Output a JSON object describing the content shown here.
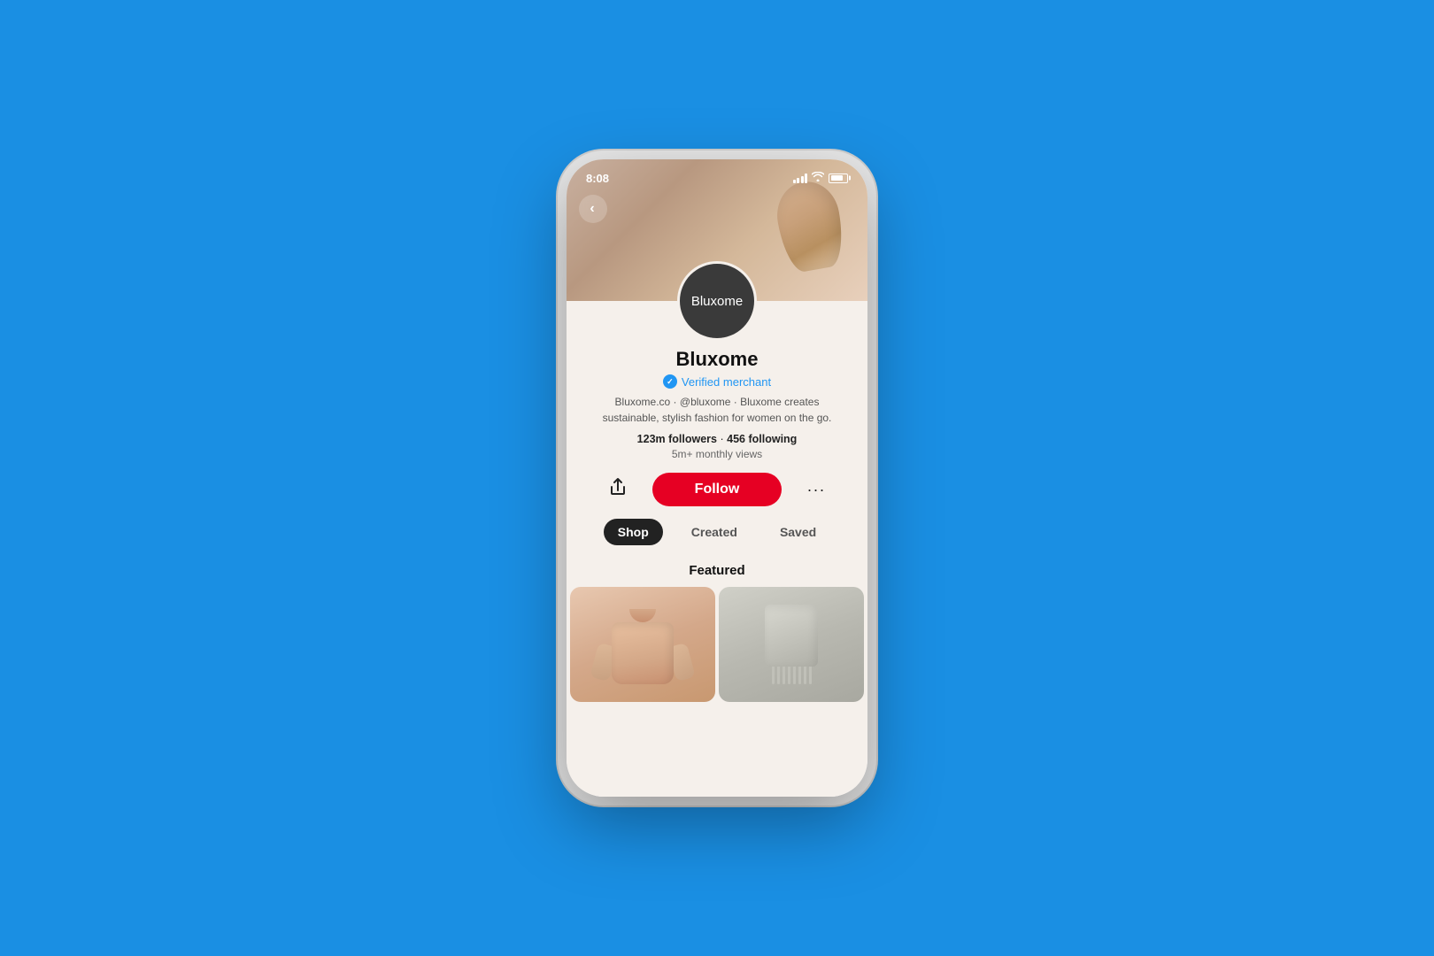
{
  "background_color": "#1a8fe3",
  "phone": {
    "status_bar": {
      "time": "8:08",
      "signal_label": "signal",
      "wifi_label": "wifi",
      "battery_label": "battery"
    },
    "back_button_label": "‹",
    "profile": {
      "avatar_text": "Bluxome",
      "name": "Bluxome",
      "verified_label": "Verified merchant",
      "bio": "Bluxome.co · @bluxome · Bluxome creates sustainable, stylish fashion for women on the go.",
      "followers": "123m followers",
      "following": "456 following",
      "stats_separator": "·",
      "monthly_views": "5m+ monthly views"
    },
    "actions": {
      "share_label": "share",
      "follow_label": "Follow",
      "more_label": "···"
    },
    "tabs": [
      {
        "label": "Shop",
        "active": true
      },
      {
        "label": "Created",
        "active": false
      },
      {
        "label": "Saved",
        "active": false
      }
    ],
    "featured": {
      "title": "Featured",
      "items": [
        {
          "id": "item-1",
          "type": "sweater",
          "color": "#e8c8b0"
        },
        {
          "id": "item-2",
          "type": "blanket",
          "color": "#c8c8c0"
        }
      ]
    }
  }
}
